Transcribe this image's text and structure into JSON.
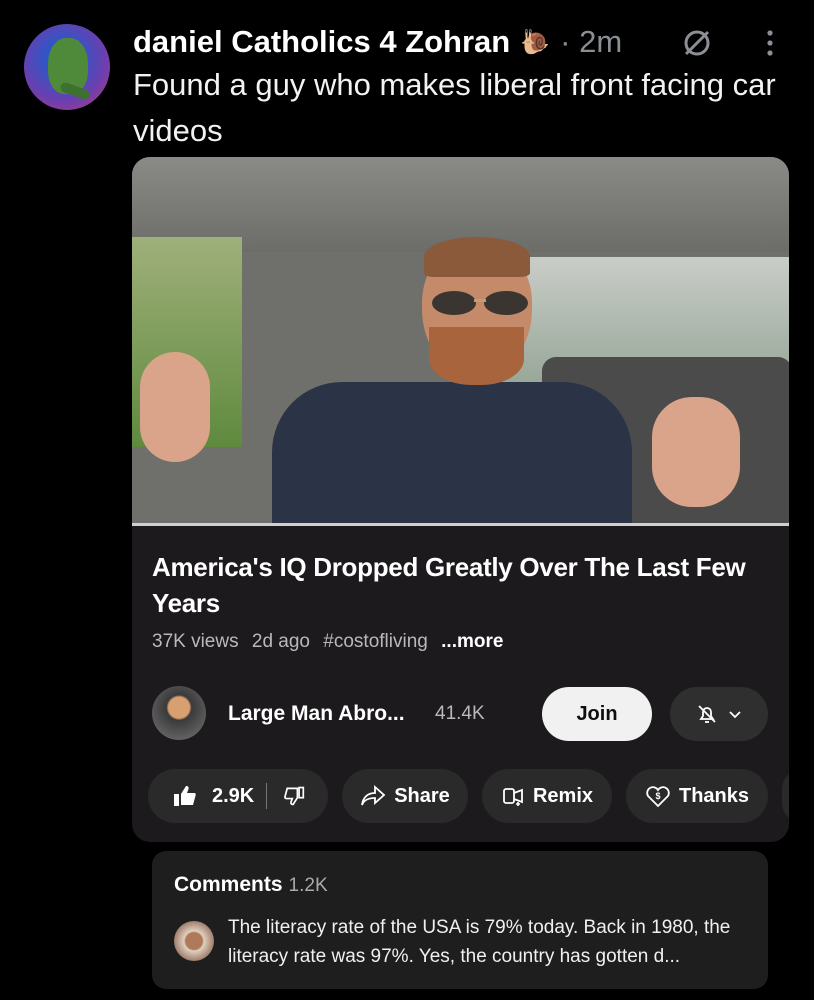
{
  "post": {
    "author": "daniel Catholics 4 Zohran",
    "author_emoji": "🐌",
    "time": "· 2m",
    "text": "Found a guy who makes liberal front facing car videos"
  },
  "video": {
    "title": "America's IQ Dropped Greatly Over The Last Few Years",
    "views": "37K views",
    "age": "2d ago",
    "hashtag": "#costofliving",
    "more": "...more",
    "channel_name": "Large Man Abro...",
    "channel_subs": "41.4K",
    "join_label": "Join",
    "likes": "2.9K",
    "share_label": "Share",
    "remix_label": "Remix",
    "thanks_label": "Thanks"
  },
  "comments": {
    "label": "Comments",
    "count": "1.2K",
    "top_comment": "The literacy rate of the USA is 79% today. Back in 1980, the literacy rate was 97%. Yes, the country has gotten d..."
  },
  "colors": {
    "background": "#000000",
    "card": "#1c1a1c",
    "pill": "#2a2a2a",
    "muted_text": "#8b8f95",
    "join_bg": "#f1f1f1"
  },
  "icons": [
    "hide-post-icon",
    "more-vertical-icon",
    "bell-off-icon",
    "chevron-down-icon",
    "thumbs-up-icon",
    "thumbs-down-icon",
    "share-arrow-icon",
    "remix-icon",
    "thanks-heart-icon"
  ]
}
